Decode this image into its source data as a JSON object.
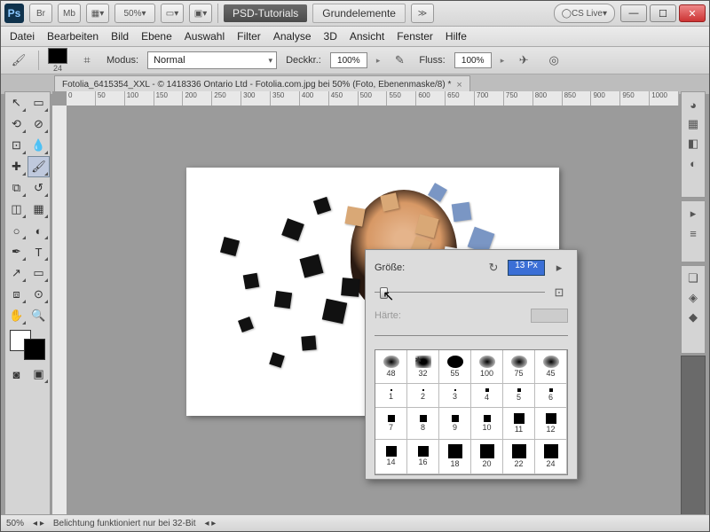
{
  "titlebar": {
    "zoom": "50%",
    "tab1": "PSD-Tutorials",
    "tab2": "Grundelemente",
    "cslive": "CS Live"
  },
  "menu": [
    "Datei",
    "Bearbeiten",
    "Bild",
    "Ebene",
    "Auswahl",
    "Filter",
    "Analyse",
    "3D",
    "Ansicht",
    "Fenster",
    "Hilfe"
  ],
  "options": {
    "brushSize": "24",
    "modeLabel": "Modus:",
    "modeValue": "Normal",
    "opacityLabel": "Deckkr.:",
    "opacityValue": "100%",
    "flowLabel": "Fluss:",
    "flowValue": "100%"
  },
  "docTab": "Fotolia_6415354_XXL - © 1418336 Ontario Ltd - Fotolia.com.jpg bei 50% (Foto, Ebenenmaske/8) *",
  "rulerH": [
    "0",
    "50",
    "100",
    "150",
    "200",
    "250",
    "300",
    "350",
    "400",
    "450",
    "500",
    "550",
    "600",
    "650",
    "700",
    "750",
    "800",
    "850",
    "900",
    "950",
    "1000"
  ],
  "status": {
    "zoom": "50%",
    "msg": "Belichtung funktioniert nur bei 32-Bit"
  },
  "brushPopup": {
    "sizeLabel": "Größe:",
    "sizeValue": "13 Px",
    "hardLabel": "Härte:",
    "presets": [
      [
        "48",
        "32",
        "55",
        "100",
        "75",
        "45"
      ],
      [
        "1",
        "2",
        "3",
        "4",
        "5",
        "6"
      ],
      [
        "7",
        "8",
        "9",
        "10",
        "11",
        "12"
      ],
      [
        "14",
        "16",
        "18",
        "20",
        "22",
        "24"
      ]
    ],
    "row0shapes": [
      "soft",
      "",
      "round",
      "soft",
      "soft",
      "soft"
    ],
    "sizes": [
      [
        "tiny",
        "tiny",
        "tiny",
        "sm",
        "sm",
        "sm"
      ],
      [
        "md",
        "md",
        "md",
        "md",
        "lg",
        "lg"
      ],
      [
        "lg",
        "lg",
        "xl",
        "xl",
        "xl",
        "xl"
      ]
    ]
  }
}
